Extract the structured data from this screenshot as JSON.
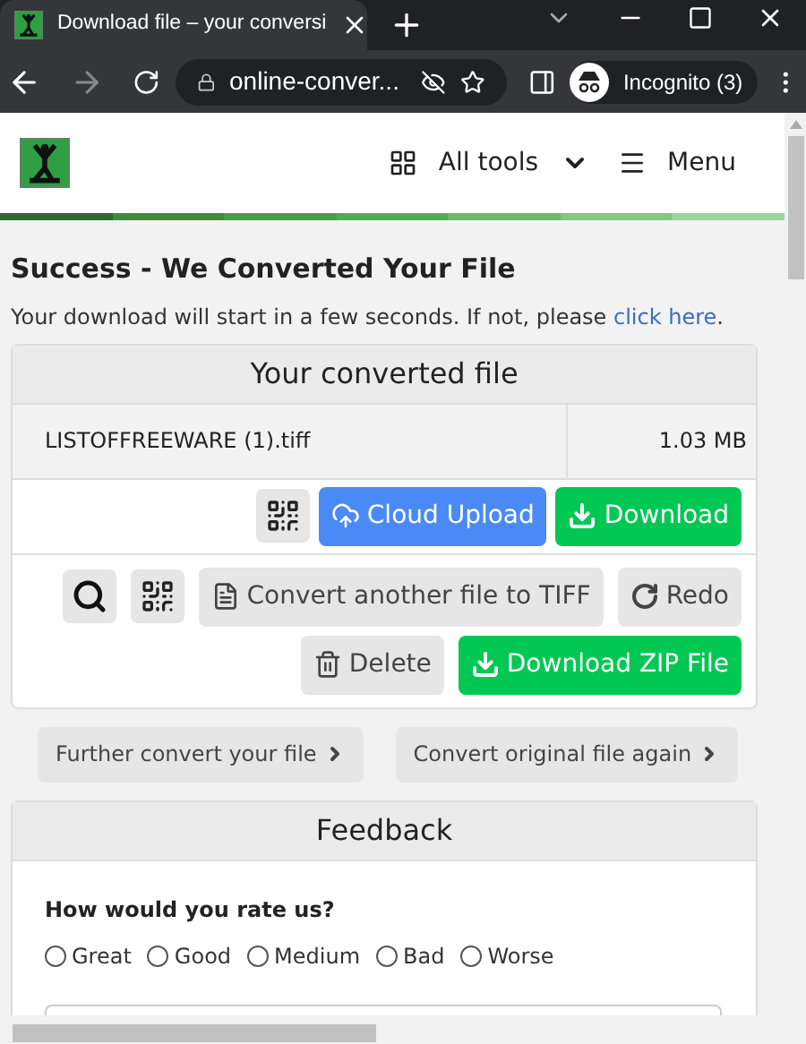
{
  "browser": {
    "tab_title": "Download file – your conversi",
    "url": "online-conver...",
    "profile": "Incognito (3)"
  },
  "header": {
    "nav": [
      {
        "kind": "tools",
        "label": "All tools"
      },
      {
        "kind": "menu",
        "label": "Menu"
      }
    ]
  },
  "message": {
    "title": "Success - We Converted Your File",
    "text": "Your download will start in a few seconds. If not, please ",
    "link": "click here",
    "after": "."
  },
  "result": {
    "title": "Your converted file",
    "file_name": "LISTOFFREEWARE (1).tiff",
    "file_size": "1.03 MB",
    "actions_1": [
      {
        "kind": "qr"
      },
      {
        "kind": "cloud",
        "label": "Cloud Upload"
      },
      {
        "kind": "download",
        "label": "Download"
      }
    ],
    "actions_2": [
      {
        "kind": "search"
      },
      {
        "kind": "qr"
      },
      {
        "kind": "file",
        "label": "Convert another file to TIFF"
      },
      {
        "kind": "redo",
        "label": "Redo"
      }
    ],
    "actions_3": [
      {
        "kind": "delete",
        "label": "Delete"
      },
      {
        "kind": "download",
        "label": "Download ZIP File"
      }
    ]
  },
  "more": [
    {
      "label": "Further convert your file"
    },
    {
      "label": "Convert original file again"
    }
  ],
  "feedback": {
    "title": "Feedback",
    "question": "How would you rate us?",
    "options": [
      {
        "label": "Great",
        "selected": false
      },
      {
        "label": "Good",
        "selected": false
      },
      {
        "label": "Medium",
        "selected": false
      },
      {
        "label": "Bad",
        "selected": false
      },
      {
        "label": "Worse",
        "selected": false
      }
    ]
  }
}
